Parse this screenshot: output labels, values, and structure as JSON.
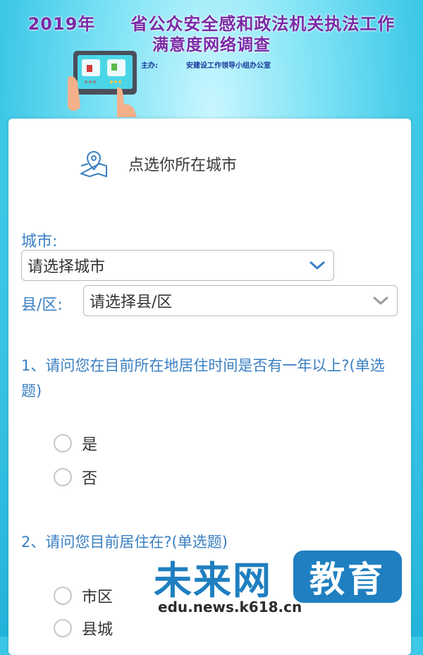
{
  "header": {
    "title_line1": "2019年　　省公众安全感和政法机关执法工作",
    "title_line2": "满意度网络调查",
    "sponsor": "主办:　　　　安建设工作领导小组办公室",
    "colors": {
      "title": "#7a2aa6",
      "accent": "#3a7fc3"
    }
  },
  "location": {
    "heading": "点选你所在城市",
    "city_label": "城市:",
    "city_placeholder": "请选择城市",
    "district_label": "县/区:",
    "district_placeholder": "请选择县/区"
  },
  "questions": [
    {
      "text": "1、请问您在目前所在地居住时间是否有一年以上?(单选题)",
      "options": [
        "是",
        "否"
      ]
    },
    {
      "text": "2、请问您目前居住在?(单选题)",
      "options": [
        "市区",
        "县城"
      ]
    }
  ],
  "watermark": {
    "main": "未来网",
    "badge": "教育",
    "url": "edu.news.k618.cn"
  }
}
